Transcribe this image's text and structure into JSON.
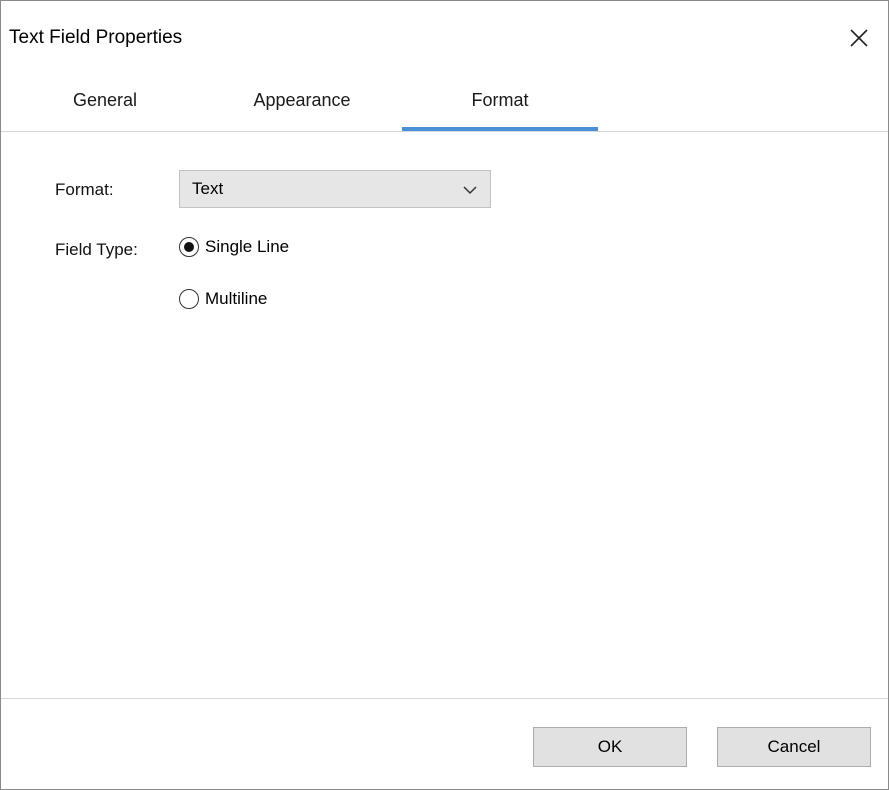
{
  "dialog": {
    "title": "Text Field Properties",
    "close_icon": "close-icon"
  },
  "tabs": [
    {
      "label": "General",
      "active": false
    },
    {
      "label": "Appearance",
      "active": false
    },
    {
      "label": "Format",
      "active": true
    }
  ],
  "accent_color": "#4a90d9",
  "format": {
    "label": "Format:",
    "selected": "Text",
    "icon": "chevron-down-icon"
  },
  "field_type": {
    "label": "Field Type:",
    "options": [
      {
        "label": "Single Line",
        "selected": true
      },
      {
        "label": "Multiline",
        "selected": false
      }
    ]
  },
  "buttons": {
    "ok": "OK",
    "cancel": "Cancel"
  }
}
